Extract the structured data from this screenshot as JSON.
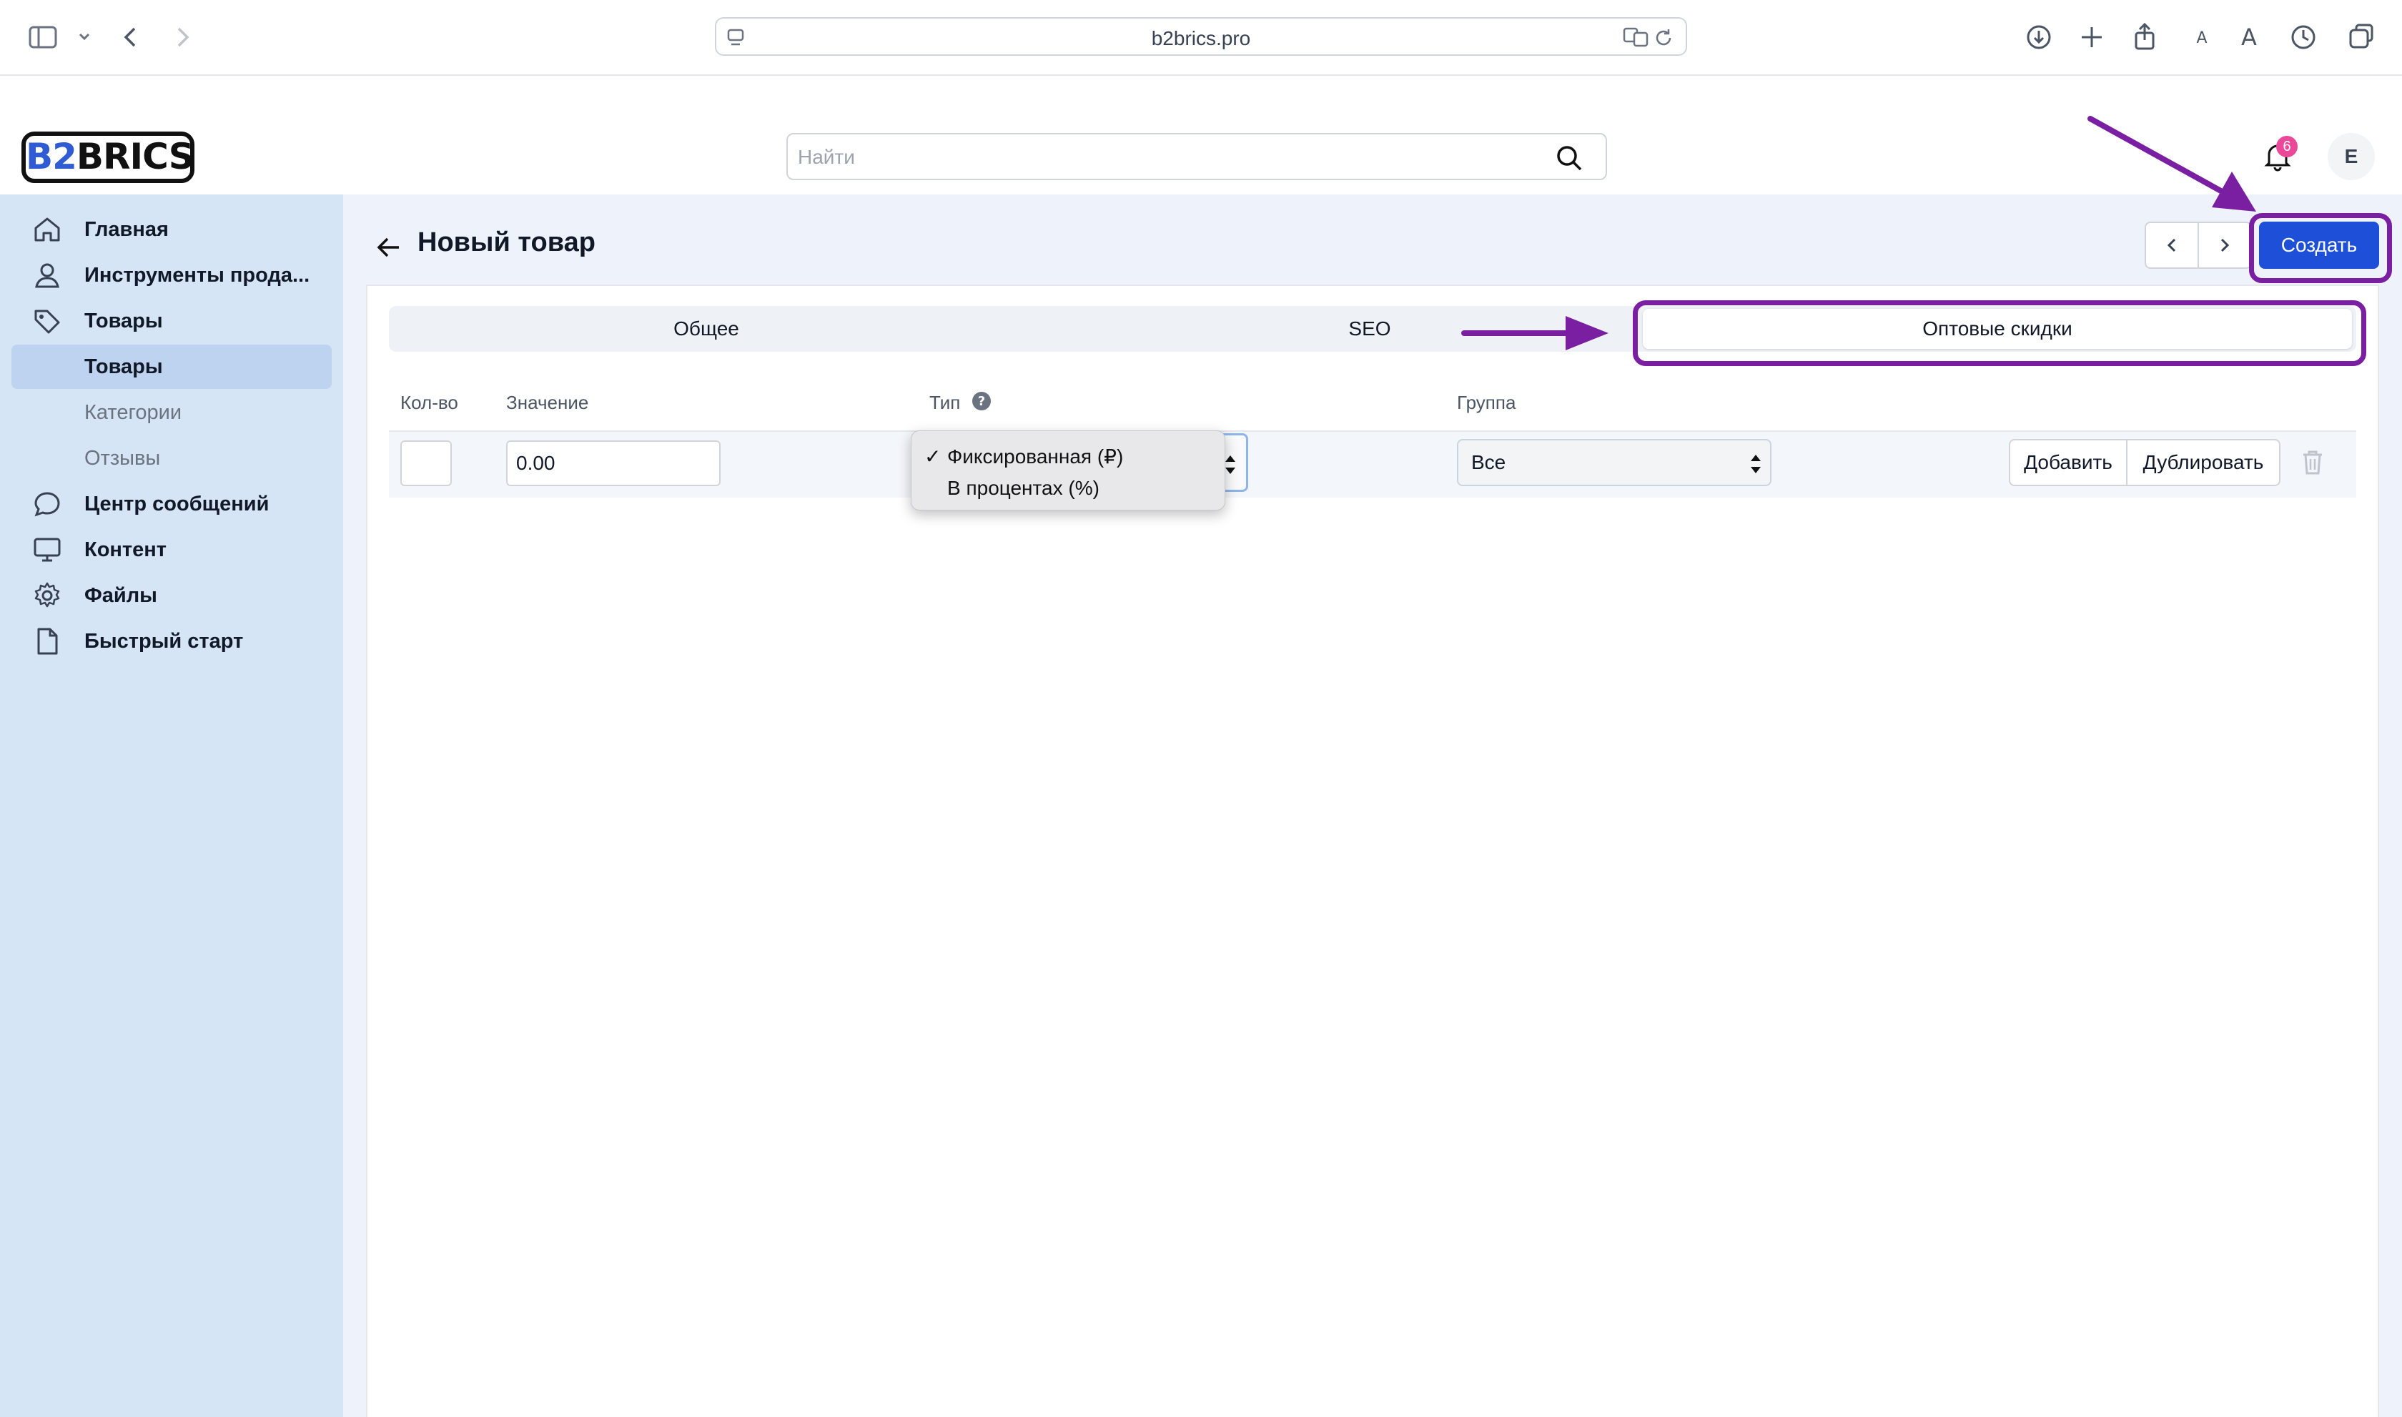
{
  "browser": {
    "url": "b2brics.pro"
  },
  "app": {
    "logo_b2": "B2",
    "logo_rest": "BRICS",
    "search_placeholder": "Найти",
    "notification_count": "6",
    "avatar_initial": "E"
  },
  "sidebar": {
    "items": [
      {
        "label": "Главная",
        "icon": "home-icon"
      },
      {
        "label": "Инструменты прода...",
        "icon": "user-icon"
      },
      {
        "label": "Товары",
        "icon": "tag-icon"
      },
      {
        "label": "Товары",
        "sub": true,
        "active": true
      },
      {
        "label": "Категории",
        "sub": true
      },
      {
        "label": "Отзывы",
        "sub": true
      },
      {
        "label": "Центр сообщений",
        "icon": "chat-icon"
      },
      {
        "label": "Контент",
        "icon": "monitor-icon"
      },
      {
        "label": "Файлы",
        "icon": "gear-icon"
      },
      {
        "label": "Быстрый старт",
        "icon": "file-icon"
      }
    ]
  },
  "page": {
    "title": "Новый товар",
    "create_label": "Создать"
  },
  "tabs": [
    {
      "label": "Общее"
    },
    {
      "label": "SEO"
    },
    {
      "label": "Оптовые скидки",
      "active": true
    }
  ],
  "table": {
    "headers": [
      "Кол-во",
      "Значение",
      "Тип",
      "Группа"
    ],
    "row": {
      "qty": "",
      "value": "0.00",
      "group": "Все",
      "add_label": "Добавить",
      "duplicate_label": "Дублировать"
    }
  },
  "type_dropdown": {
    "options": [
      {
        "label": "Фиксированная (₽)",
        "selected": true
      },
      {
        "label": "В процентах (%)",
        "selected": false
      }
    ],
    "check": "✓"
  },
  "colors": {
    "accent": "#1d4fd8",
    "annotation": "#7b1fa2",
    "sidebar_bg": "#d6e5f6",
    "badge": "#ec4899"
  }
}
